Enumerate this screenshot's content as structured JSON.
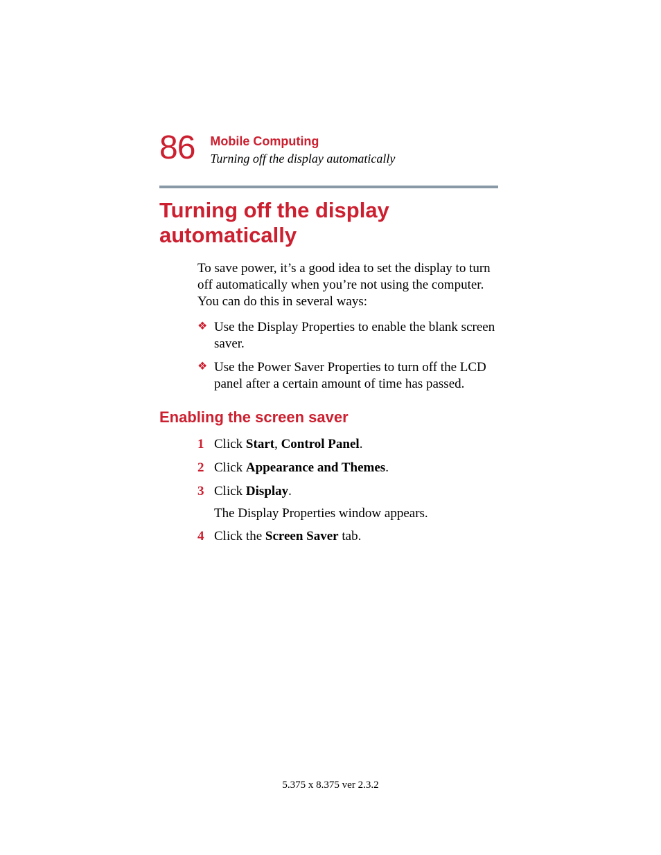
{
  "header": {
    "page_number": "86",
    "chapter": "Mobile Computing",
    "subtitle": "Turning off the display automatically"
  },
  "main": {
    "heading": "Turning off the display automatically",
    "intro": "To save power, it’s a good idea to set the display to turn off automatically when you’re not using the computer. You can do this in several ways:",
    "bullets": [
      "Use the Display Properties to enable the blank screen saver.",
      "Use the Power Saver Properties to turn off the LCD panel after a certain amount of time has passed."
    ],
    "subheading": "Enabling the screen saver",
    "steps": [
      {
        "num": "1",
        "pre": "Click ",
        "bold1": "Start",
        "mid": ", ",
        "bold2": "Control Panel",
        "post": "."
      },
      {
        "num": "2",
        "pre": "Click ",
        "bold1": "Appearance and Themes",
        "post": "."
      },
      {
        "num": "3",
        "pre": "Click ",
        "bold1": "Display",
        "post": ".",
        "sub": "The Display Properties window appears."
      },
      {
        "num": "4",
        "pre": "Click the ",
        "bold1": "Screen Saver",
        "post": " tab."
      }
    ]
  },
  "footer": "5.375 x 8.375 ver 2.3.2"
}
